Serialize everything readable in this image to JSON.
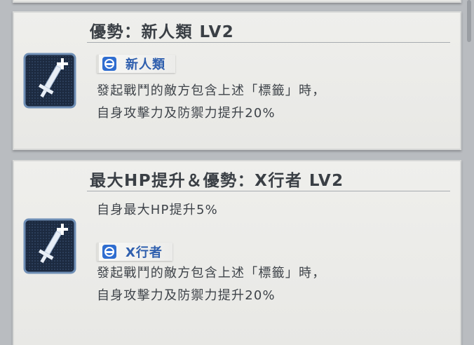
{
  "colors": {
    "tag_text": "#2f5fae",
    "text_primary": "#3a3f45",
    "card_bg": "#efefec",
    "icon_bg": "#1c2a40",
    "icon_border": "#6f8fb6"
  },
  "skills": [
    {
      "title": "優勢：新人類 LV2",
      "icon": "sword-plus-icon",
      "tag": {
        "icon": "tag-helmet-icon",
        "label": "新人類"
      },
      "pre_desc": "",
      "desc_lines": [
        "發起戰鬥的敵方包含上述「標籤」時，",
        "自身攻擊力及防禦力提升20%"
      ]
    },
    {
      "title": "最大HP提升＆優勢：X行者 LV2",
      "icon": "sword-plus-icon",
      "tag": {
        "icon": "tag-helmet-icon",
        "label": "X行者"
      },
      "pre_desc": "自身最大HP提升5%",
      "desc_lines": [
        "發起戰鬥的敵方包含上述「標籤」時，",
        "自身攻擊力及防禦力提升20%"
      ]
    }
  ]
}
